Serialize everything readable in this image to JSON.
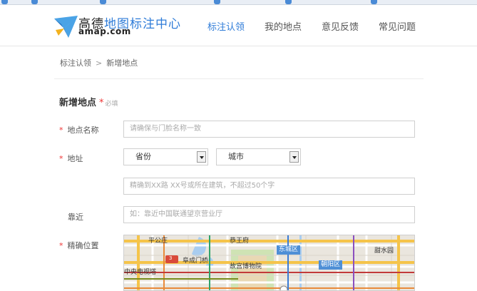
{
  "header": {
    "brand_cn_1": "高德",
    "brand_cn_2": "地图标注中心",
    "brand_en": "amap.com",
    "nav": [
      "标注认领",
      "我的地点",
      "意见反馈",
      "常见问题"
    ]
  },
  "breadcrumb": {
    "root": "标注认领",
    "sep": ">",
    "current": "新增地点"
  },
  "form": {
    "title": "新增地点",
    "required_star": "*",
    "required_hint": "必填",
    "name_label": "地点名称",
    "name_placeholder": "请确保与门脸名称一致",
    "address_label": "地址",
    "province_value": "省份",
    "city_value": "城市",
    "address_placeholder": "精确到XX路 XX号或所在建筑，不超过50个字",
    "near_label": "靠近",
    "near_placeholder": "如：靠近中国联通望京营业厅",
    "location_label": "精确位置"
  },
  "map": {
    "labels": [
      "平公庄",
      "阜成门桥",
      "恭王府",
      "东城区",
      "甜水园",
      "中央电视塔",
      "故宫博物院",
      "朝阳区"
    ],
    "road_sign": "3",
    "colors": {
      "base": "#eae6de",
      "water": "#a9cdf0",
      "park": "#cfe3b4",
      "major_road": "#f5c44a",
      "minor_road": "#ffffff",
      "district_label": "#4e8fd6"
    }
  },
  "colors": {
    "accent": "#2f7cd8",
    "required": "#e33333"
  }
}
